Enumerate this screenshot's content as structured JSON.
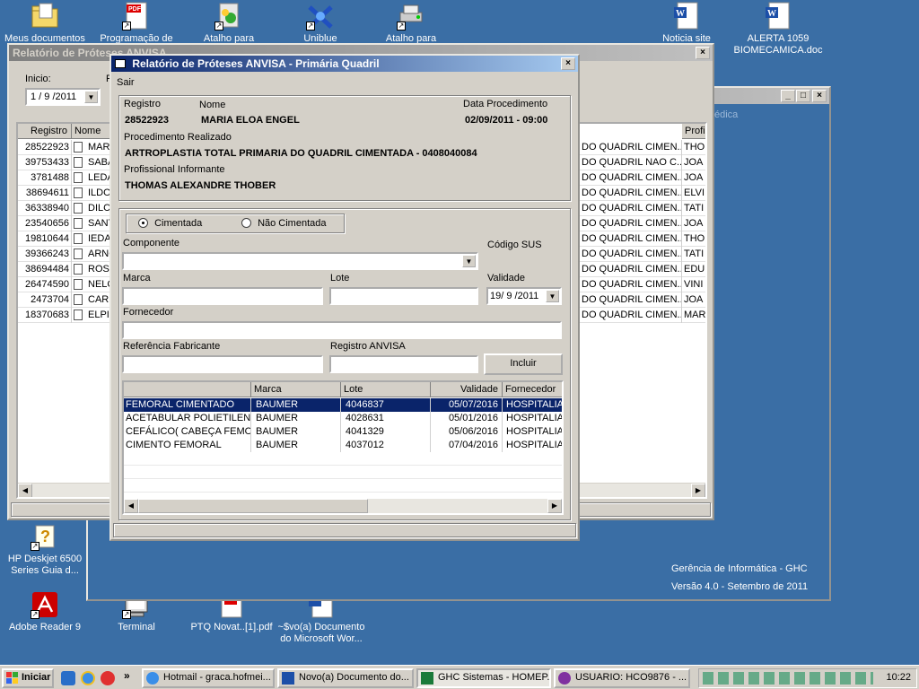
{
  "desktop": {
    "icons": [
      {
        "label": "Meus documentos"
      },
      {
        "label": "Programação de"
      },
      {
        "label": "Atalho para"
      },
      {
        "label": "Uniblue"
      },
      {
        "label": "Atalho para"
      },
      {
        "label": "Noticia site"
      },
      {
        "label": "ALERTA 1059 BIOMECAMICA.doc"
      },
      {
        "label": "HP Deskjet 6500 Series Guia d..."
      },
      {
        "label": "Adobe Reader 9"
      },
      {
        "label": "Terminal"
      },
      {
        "label": "PTQ Novat..[1].pdf"
      },
      {
        "label": "~$vo(a) Documento do Microsoft Wor..."
      }
    ]
  },
  "bg_window": {
    "side_label": "édica",
    "footer_line1": "Gerência de Informática - GHC",
    "footer_line2": "Versão 4.0 - Setembro de 2011"
  },
  "report_window": {
    "title": "Relatório de Próteses ANVISA",
    "start_label": "Inicio:",
    "start_value": "1 / 9 /2011",
    "f_label": "F",
    "columns": {
      "registro": "Registro",
      "nome": "Nome",
      "profi": "Profi"
    },
    "rows": [
      {
        "registro": "28522923",
        "nome": "MAR",
        "proc": "DO QUADRIL CIMEN...",
        "prof": "THO"
      },
      {
        "registro": "39753433",
        "nome": "SABA",
        "proc": "DO QUADRIL NAO C...",
        "prof": "JOA"
      },
      {
        "registro": "3781488",
        "nome": "LEDA",
        "proc": "DO QUADRIL CIMEN...",
        "prof": "JOA"
      },
      {
        "registro": "38694611",
        "nome": "ILDO",
        "proc": "DO QUADRIL CIMEN...",
        "prof": "ELVI"
      },
      {
        "registro": "36338940",
        "nome": "DILCI",
        "proc": "DO QUADRIL CIMEN...",
        "prof": "TATI"
      },
      {
        "registro": "23540656",
        "nome": "SANT",
        "proc": "DO QUADRIL CIMEN...",
        "prof": "JOA"
      },
      {
        "registro": "19810644",
        "nome": "IEDA",
        "proc": "DO QUADRIL CIMEN...",
        "prof": "THO"
      },
      {
        "registro": "39366243",
        "nome": "ARNO",
        "proc": "DO QUADRIL CIMEN...",
        "prof": "TATI"
      },
      {
        "registro": "38694484",
        "nome": "ROSI",
        "proc": "DO QUADRIL CIMEN...",
        "prof": "EDU"
      },
      {
        "registro": "26474590",
        "nome": "NELC",
        "proc": "DO QUADRIL CIMEN...",
        "prof": "VINI"
      },
      {
        "registro": "2473704",
        "nome": "CARI",
        "proc": "DO QUADRIL CIMEN...",
        "prof": "JOA"
      },
      {
        "registro": "18370683",
        "nome": "ELPID",
        "proc": "DO QUADRIL CIMEN...",
        "prof": "MAR"
      }
    ]
  },
  "dialog": {
    "title": "Relatório de Próteses ANVISA - Primária Quadril",
    "menu_sair": "Sair",
    "registro_label": "Registro",
    "registro_value": "28522923",
    "nome_label": "Nome",
    "nome_value": "MARIA ELOA ENGEL",
    "data_label": "Data Procedimento",
    "data_value": "02/09/2011 - 09:00",
    "proc_label": "Procedimento Realizado",
    "proc_value": "ARTROPLASTIA TOTAL PRIMARIA DO QUADRIL CIMENTADA - 0408040084",
    "prof_label": "Profissional Informante",
    "prof_value": "THOMAS ALEXANDRE THOBER",
    "radio_cimentada": "Cimentada",
    "radio_nao_cimentada": "Não Cimentada",
    "componente_label": "Componente",
    "codigo_sus_label": "Código SUS",
    "marca_label": "Marca",
    "lote_label": "Lote",
    "validade_label": "Validade",
    "validade_value": "19/ 9 /2011",
    "fornecedor_label": "Fornecedor",
    "ref_label": "Referência Fabricante",
    "anvisa_label": "Registro ANVISA",
    "incluir_label": "Incluir",
    "grid_columns": {
      "comp": "",
      "marca": "Marca",
      "lote": "Lote",
      "validade": "Validade",
      "fornecedor": "Fornecedor"
    },
    "items": [
      {
        "comp": "FEMORAL CIMENTADO",
        "marca": "BAUMER",
        "lote": "4046837",
        "validade": "05/07/2016",
        "fornecedor": "HOSPITALIA"
      },
      {
        "comp": "ACETABULAR POLIETILEN...",
        "marca": "BAUMER",
        "lote": "4028631",
        "validade": "05/01/2016",
        "fornecedor": "HOSPITALIA"
      },
      {
        "comp": "CEFÁLICO( CABEÇA FEMO...",
        "marca": "BAUMER",
        "lote": "4041329",
        "validade": "05/06/2016",
        "fornecedor": "HOSPITALIA"
      },
      {
        "comp": "CIMENTO FEMORAL",
        "marca": "BAUMER",
        "lote": "4037012",
        "validade": "07/04/2016",
        "fornecedor": "HOSPITALIA"
      }
    ]
  },
  "taskbar": {
    "start": "Iniciar",
    "items": [
      "Hotmail - graca.hofmei...",
      "Novo(a) Documento do...",
      "GHC Sistemas - HOMEP...",
      "USUARIO: HCO9876 - ..."
    ],
    "clock": "10:22"
  },
  "colors": {
    "desktop": "#3a6ea5",
    "title_active": "#0a246a",
    "selection": "#0a246a"
  }
}
